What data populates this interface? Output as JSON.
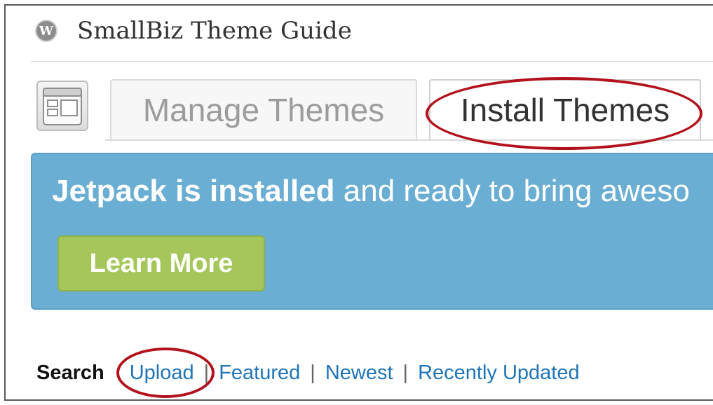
{
  "header": {
    "logo_icon": "wordpress-logo-icon",
    "logo_glyph": "W",
    "site_title": "SmallBiz Theme Guide"
  },
  "tabs": [
    {
      "label": "Manage Themes",
      "active": false
    },
    {
      "label": "Install Themes",
      "active": true
    }
  ],
  "notice": {
    "bold_text": "Jetpack is installed",
    "text": " and ready to bring aweso",
    "button_label": "Learn More",
    "colors": {
      "background": "#6aaed3",
      "button": "#a5c65a"
    }
  },
  "subnav": {
    "current": "Search",
    "links": [
      "Upload",
      "Featured",
      "Newest",
      "Recently Updated"
    ],
    "separator": "|"
  },
  "annotations": {
    "highlight_color": "#b3111b",
    "highlighted": [
      "Install Themes",
      "Upload"
    ]
  }
}
